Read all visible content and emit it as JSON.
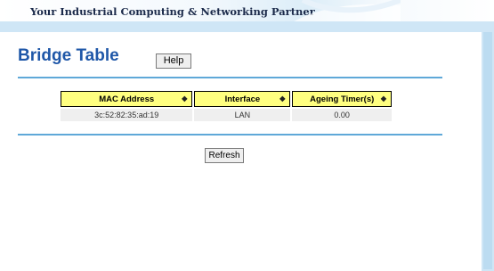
{
  "header": {
    "tagline": "Your Industrial Computing & Networking Partner"
  },
  "page": {
    "title": "Bridge Table"
  },
  "buttons": {
    "help": "Help",
    "refresh": "Refresh"
  },
  "table": {
    "columns": [
      {
        "label": "MAC Address",
        "sort_icon": "sort-both-arrows"
      },
      {
        "label": "Interface",
        "sort_icon": "sort-both-arrows"
      },
      {
        "label": "Ageing Timer(s)",
        "sort_icon": "sort-both-arrows"
      }
    ],
    "rows": [
      {
        "mac": "3c:52:82:35:ad:19",
        "interface": "LAN",
        "ageing": "0.00"
      }
    ]
  },
  "colors": {
    "title": "#1f57a8",
    "header_band": "#cfe6f6",
    "rule": "#5fa8d8",
    "column_header_bg": "#ffff80",
    "row_bg": "#efefef"
  },
  "icons": {
    "sort": "◆"
  }
}
